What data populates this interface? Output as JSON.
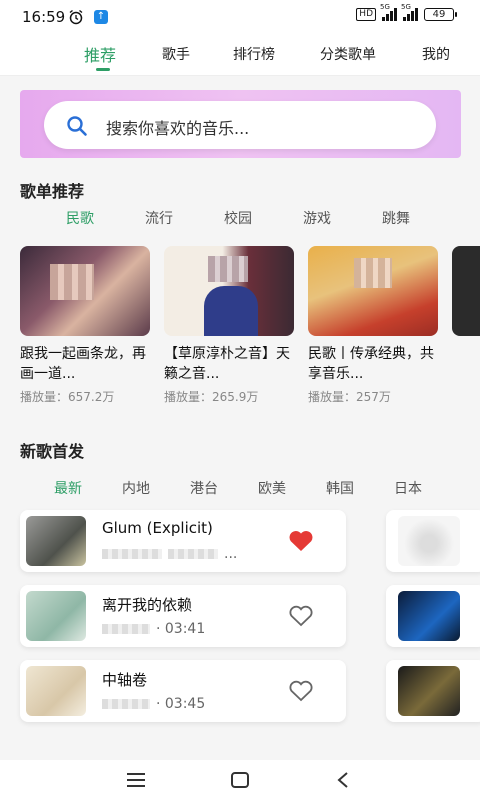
{
  "status": {
    "time": "16:59",
    "hd": "HD",
    "net1": "5G",
    "net2": "5G",
    "battery": "49"
  },
  "nav": {
    "tabs": [
      "推荐",
      "歌手",
      "排行榜",
      "分类歌单",
      "我的"
    ]
  },
  "search": {
    "placeholder": "搜索你喜欢的音乐..."
  },
  "playlists": {
    "title": "歌单推荐",
    "chips": [
      "民歌",
      "流行",
      "校园",
      "游戏",
      "跳舞"
    ],
    "items": [
      {
        "title": "跟我一起画条龙，再画一道...",
        "plays": "播放量：657.2万"
      },
      {
        "title": "【草原淳朴之音】天籁之音...",
        "plays": "播放量：265.9万"
      },
      {
        "title": "民歌丨传承经典，共享音乐...",
        "plays": "播放量：257万"
      }
    ]
  },
  "newsongs": {
    "title": "新歌首发",
    "chips": [
      "最新",
      "内地",
      "港台",
      "欧美",
      "韩国",
      "日本"
    ],
    "items": [
      {
        "name": "Glum (Explicit)",
        "meta": "...",
        "liked": true
      },
      {
        "name": "离开我的依赖",
        "meta": "· 03:41",
        "liked": false
      },
      {
        "name": "中轴卷",
        "meta": "· 03:45",
        "liked": false
      }
    ]
  },
  "colors": {
    "accent": "#2e9e66",
    "heart": "#e53935"
  }
}
